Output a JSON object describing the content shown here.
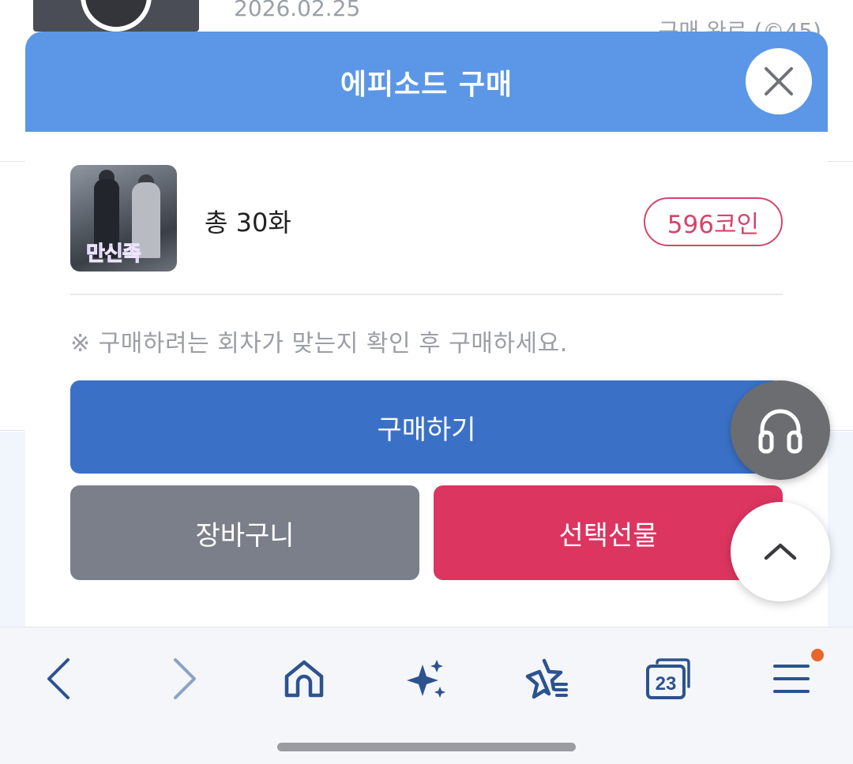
{
  "background": {
    "episode_date": "2026.02.25",
    "episode_status": "구매 완료 (©45)"
  },
  "modal": {
    "title": "에피소드 구매",
    "close_icon": "close-icon",
    "product": {
      "cover_logo_text": "만신족",
      "episode_count": "총 30화",
      "price": "596코인"
    },
    "notice": "※ 구매하려는 회차가 맞는지 확인 후 구매하세요.",
    "buy_button": "구매하기",
    "cart_button": "장바구니",
    "gift_button": "선택선물"
  },
  "floating": {
    "audio_icon": "headphones-icon",
    "scroll_top_icon": "chevron-up-icon"
  },
  "toolbar": {
    "back_icon": "chevron-left-icon",
    "forward_icon": "chevron-right-icon",
    "home_icon": "home-icon",
    "ai_icon": "sparkle-icon",
    "favorites_icon": "star-list-icon",
    "tab_count": "23",
    "menu_icon": "menu-icon"
  },
  "colors": {
    "header": "#5b97e6",
    "buy": "#3a71c7",
    "cart": "#7b7f89",
    "gift": "#dc3560",
    "price": "#d4456a",
    "toolbar_icon": "#2c5390",
    "notification_dot": "#e8652b"
  }
}
